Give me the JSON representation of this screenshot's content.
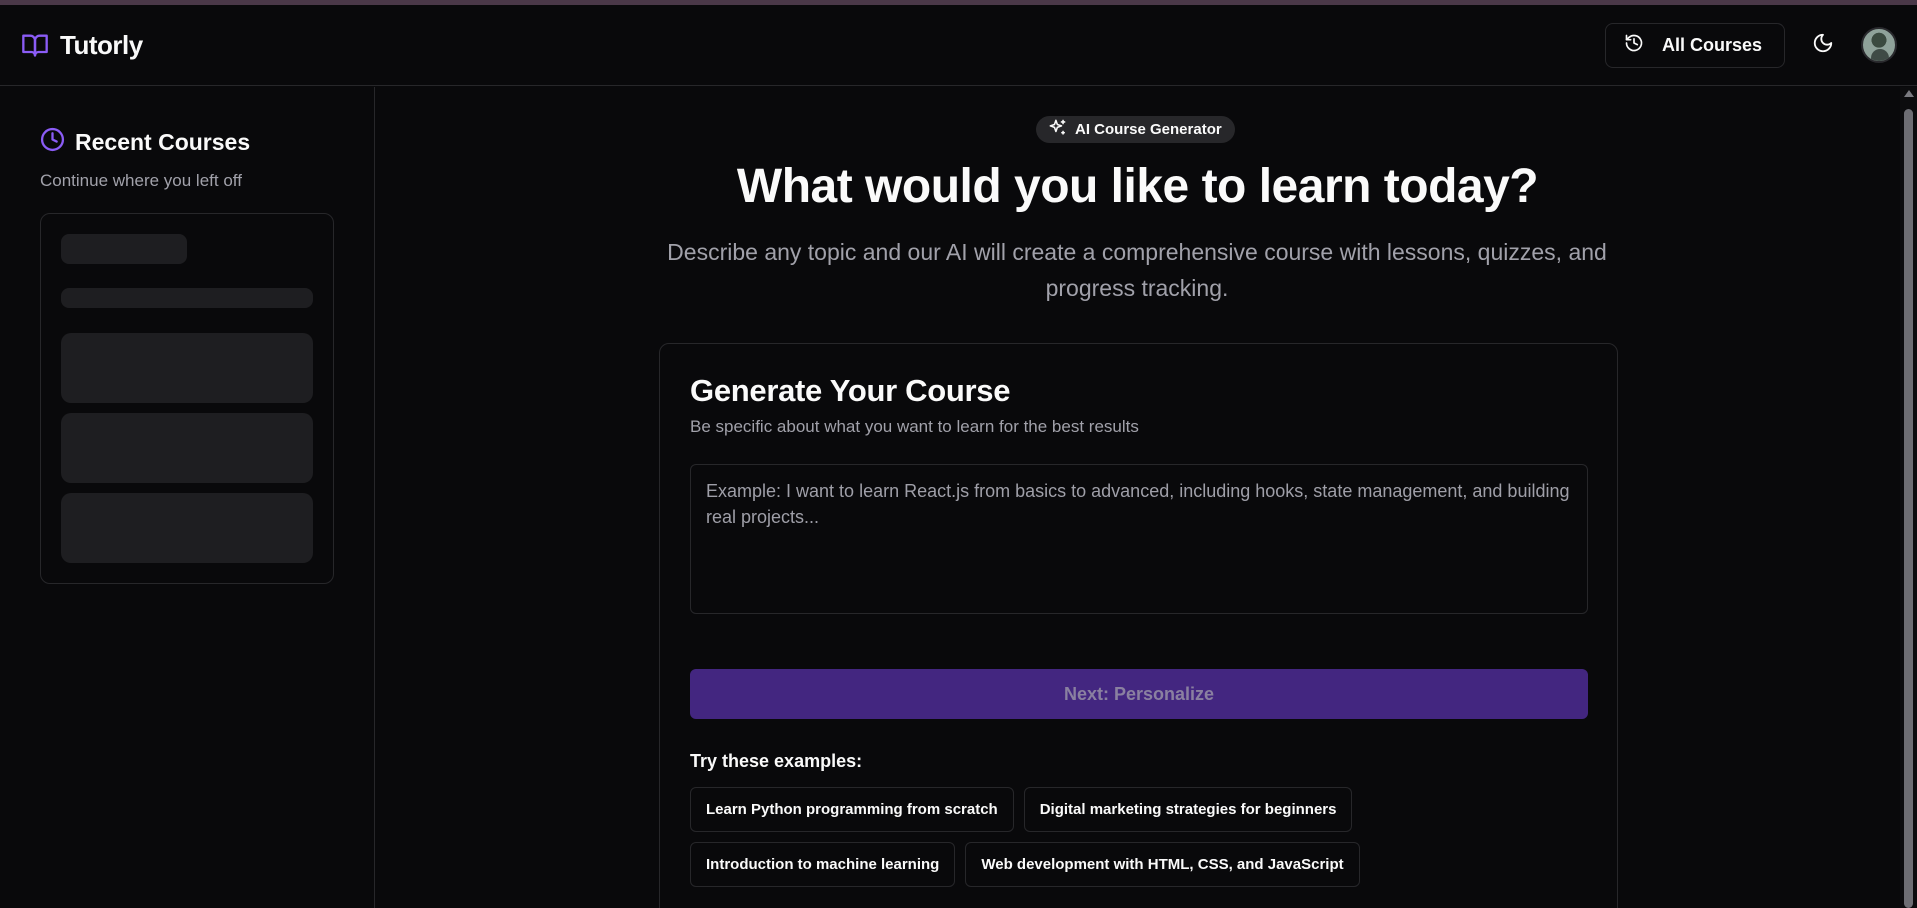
{
  "header": {
    "brand_name": "Tutorly",
    "logo_icon": "book-open-icon",
    "all_courses_label": "All Courses",
    "all_courses_icon": "history-icon",
    "theme_icon": "moon-icon",
    "accent": "#8b5cf6"
  },
  "sidebar": {
    "title": "Recent Courses",
    "title_icon": "clock-icon",
    "subtitle": "Continue where you left off"
  },
  "main": {
    "badge": "AI Course Generator",
    "badge_icon": "sparkles-icon",
    "headline": "What would you like to learn today?",
    "subline": "Describe any topic and our AI will create a comprehensive course with lessons, quizzes, and progress tracking."
  },
  "generator": {
    "title": "Generate Your Course",
    "subtitle": "Be specific about what you want to learn for the best results",
    "input_value": "",
    "input_placeholder": "Example: I want to learn React.js from basics to advanced, including hooks, state management, and building real projects...",
    "next_label": "Next: Personalize",
    "next_color": "#432680",
    "examples_label": "Try these examples:",
    "examples": [
      "Learn Python programming from scratch",
      "Digital marketing strategies for beginners",
      "Introduction to machine learning",
      "Web development with HTML, CSS, and JavaScript"
    ]
  }
}
